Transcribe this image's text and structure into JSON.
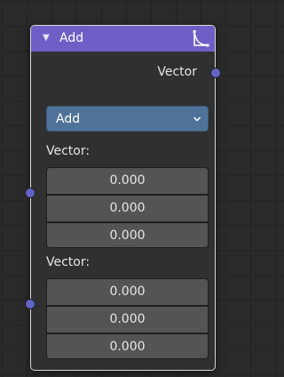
{
  "node": {
    "title": "Add",
    "output_label": "Vector",
    "operation": "Add",
    "inputs": [
      {
        "label": "Vector:",
        "values": [
          "0.000",
          "0.000",
          "0.000"
        ]
      },
      {
        "label": "Vector:",
        "values": [
          "0.000",
          "0.000",
          "0.000"
        ]
      }
    ]
  },
  "colors": {
    "header": "#6f5ec6",
    "socket": "#6363c7",
    "dropdown": "#4f7298",
    "field": "#545454",
    "canvas": "#2a2a2a"
  },
  "icons": {
    "collapse": "triangle-down-icon",
    "preview": "curve-preview-icon",
    "dropdown": "chevron-down-icon"
  }
}
